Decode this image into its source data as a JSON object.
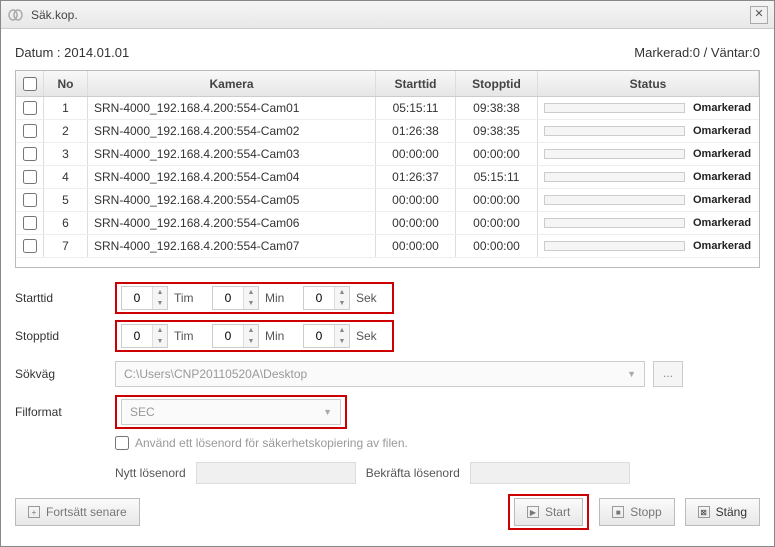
{
  "window": {
    "title": "Säk.kop."
  },
  "header": {
    "date_label": "Datum : 2014.01.01",
    "selected_label": "Markerad:0 / Väntar:0"
  },
  "table": {
    "columns": {
      "no": "No",
      "camera": "Kamera",
      "start": "Starttid",
      "stop": "Stopptid",
      "status": "Status"
    },
    "rows": [
      {
        "no": "1",
        "camera": "SRN-4000_192.168.4.200:554-Cam01",
        "start": "05:15:11",
        "stop": "09:38:38",
        "status": "Omarkerad"
      },
      {
        "no": "2",
        "camera": "SRN-4000_192.168.4.200:554-Cam02",
        "start": "01:26:38",
        "stop": "09:38:35",
        "status": "Omarkerad"
      },
      {
        "no": "3",
        "camera": "SRN-4000_192.168.4.200:554-Cam03",
        "start": "00:00:00",
        "stop": "00:00:00",
        "status": "Omarkerad"
      },
      {
        "no": "4",
        "camera": "SRN-4000_192.168.4.200:554-Cam04",
        "start": "01:26:37",
        "stop": "05:15:11",
        "status": "Omarkerad"
      },
      {
        "no": "5",
        "camera": "SRN-4000_192.168.4.200:554-Cam05",
        "start": "00:00:00",
        "stop": "00:00:00",
        "status": "Omarkerad"
      },
      {
        "no": "6",
        "camera": "SRN-4000_192.168.4.200:554-Cam06",
        "start": "00:00:00",
        "stop": "00:00:00",
        "status": "Omarkerad"
      },
      {
        "no": "7",
        "camera": "SRN-4000_192.168.4.200:554-Cam07",
        "start": "00:00:00",
        "stop": "00:00:00",
        "status": "Omarkerad"
      }
    ]
  },
  "form": {
    "starttime_label": "Starttid",
    "stoptime_label": "Stopptid",
    "path_label": "Sökväg",
    "format_label": "Filformat",
    "units": {
      "hour": "Tim",
      "min": "Min",
      "sec": "Sek"
    },
    "start": {
      "h": "0",
      "m": "0",
      "s": "0"
    },
    "stop": {
      "h": "0",
      "m": "0",
      "s": "0"
    },
    "path_value": "C:\\Users\\CNP20110520A\\Desktop",
    "format_value": "SEC",
    "password_checkbox": "Använd ett lösenord för säkerhetskopiering av filen.",
    "new_password_label": "Nytt lösenord",
    "confirm_password_label": "Bekräfta lösenord"
  },
  "buttons": {
    "resume_later": "Fortsätt senare",
    "start": "Start",
    "stop": "Stopp",
    "close": "Stäng"
  }
}
